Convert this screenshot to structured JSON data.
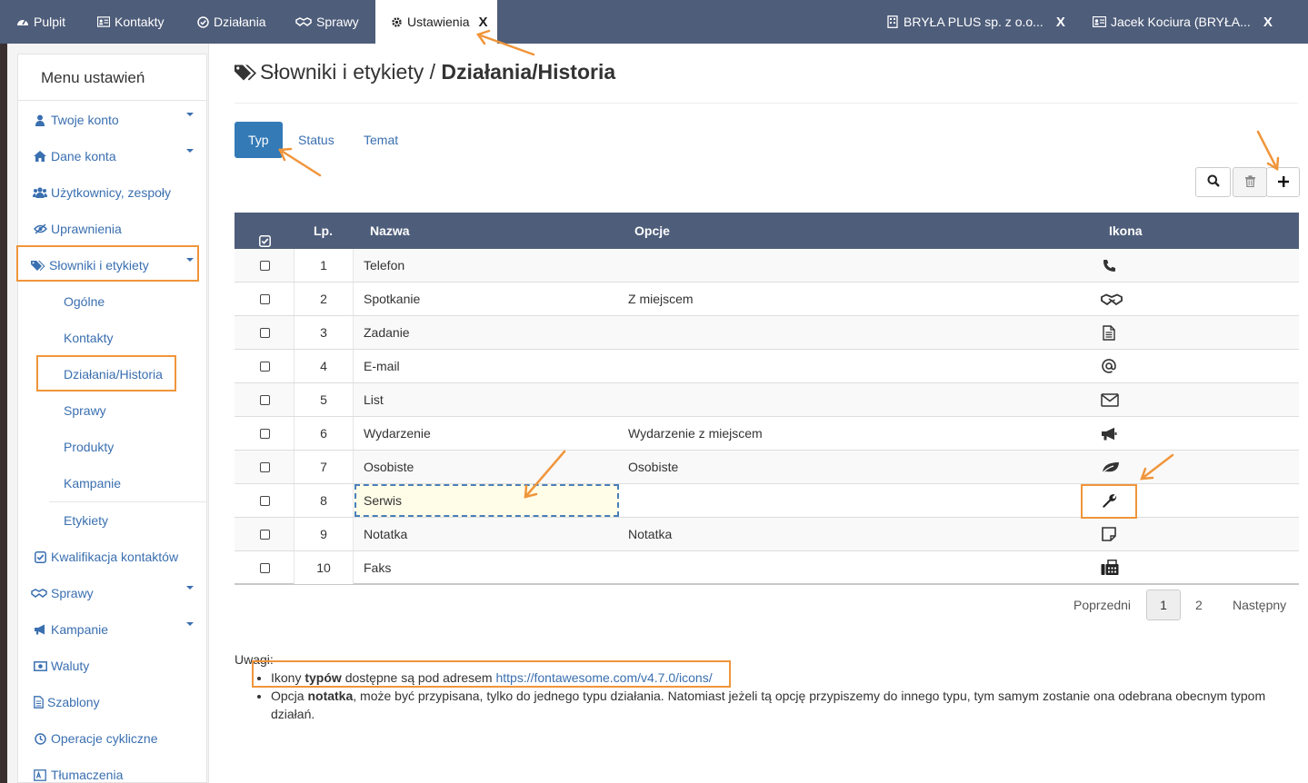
{
  "topbar": {
    "tabs": [
      {
        "label": "Pulpit",
        "icon": "dashboard-icon"
      },
      {
        "label": "Kontakty",
        "icon": "address-card-icon"
      },
      {
        "label": "Działania",
        "icon": "check-circle-icon"
      },
      {
        "label": "Sprawy",
        "icon": "handshake-icon"
      },
      {
        "label": "Ustawienia",
        "icon": "gear-icon",
        "active": true,
        "close": "X"
      },
      {
        "label": "BRYŁA PLUS sp. z o.o...",
        "icon": "building-icon",
        "close": "X"
      },
      {
        "label": "Jacek Kociura (BRYŁA...",
        "icon": "address-card-icon",
        "close": "X"
      }
    ]
  },
  "sidebar": {
    "title": "Menu ustawień",
    "items": [
      {
        "label": "Twoje konto",
        "icon": "user-icon",
        "caret": true
      },
      {
        "label": "Dane konta",
        "icon": "home-icon",
        "caret": true
      },
      {
        "label": "Użytkownicy, zespoły",
        "icon": "users-icon"
      },
      {
        "label": "Uprawnienia",
        "icon": "eye-slash-icon"
      },
      {
        "label": "Słowniki i etykiety",
        "icon": "tags-icon",
        "caret": true,
        "active": true
      },
      {
        "label": "Kwalifikacja kontaktów",
        "icon": "check-square-icon"
      },
      {
        "label": "Sprawy",
        "icon": "handshake-icon",
        "caret": true
      },
      {
        "label": "Kampanie",
        "icon": "bullhorn-icon",
        "caret": true
      },
      {
        "label": "Waluty",
        "icon": "money-icon"
      },
      {
        "label": "Szablony",
        "icon": "file-text-icon"
      },
      {
        "label": "Operacje cykliczne",
        "icon": "clock-icon"
      },
      {
        "label": "Tłumaczenia",
        "icon": "language-icon"
      }
    ],
    "subitems": [
      "Ogólne",
      "Kontakty",
      "Działania/Historia",
      "Sprawy",
      "Produkty",
      "Kampanie",
      "Etykiety"
    ]
  },
  "main": {
    "title_prefix": "Słowniki i etykiety / ",
    "title_bold": "Działania/Historia",
    "tabs": [
      "Typ",
      "Status",
      "Temat"
    ],
    "toolbar": {
      "search_icon": "search-icon",
      "delete_icon": "trash-icon",
      "add_icon": "plus-icon"
    },
    "table": {
      "headers": {
        "lp": "Lp.",
        "name": "Nazwa",
        "options": "Opcje",
        "icon": "Ikona"
      },
      "rows": [
        {
          "lp": "1",
          "name": "Telefon",
          "options": "",
          "icon": "phone-icon"
        },
        {
          "lp": "2",
          "name": "Spotkanie",
          "options": "Z miejscem",
          "icon": "handshake-icon"
        },
        {
          "lp": "3",
          "name": "Zadanie",
          "options": "",
          "icon": "file-text-icon"
        },
        {
          "lp": "4",
          "name": "E-mail",
          "options": "",
          "icon": "at-icon"
        },
        {
          "lp": "5",
          "name": "List",
          "options": "",
          "icon": "envelope-icon"
        },
        {
          "lp": "6",
          "name": "Wydarzenie",
          "options": "Wydarzenie z miejscem",
          "icon": "bullhorn-icon"
        },
        {
          "lp": "7",
          "name": "Osobiste",
          "options": "Osobiste",
          "icon": "leaf-icon"
        },
        {
          "lp": "8",
          "name": "Serwis",
          "options": "",
          "icon": "wrench-icon",
          "editing": true
        },
        {
          "lp": "9",
          "name": "Notatka",
          "options": "Notatka",
          "icon": "sticky-note-icon"
        },
        {
          "lp": "10",
          "name": "Faks",
          "options": "",
          "icon": "fax-icon"
        }
      ]
    },
    "pager": {
      "prev": "Poprzedni",
      "pages": [
        "1",
        "2"
      ],
      "current": "1",
      "next": "Następny"
    },
    "notes": {
      "heading": "Uwagi:",
      "note1_pre": "Ikony ",
      "note1_bold": "typów",
      "note1_mid": " dostępne są pod adresem ",
      "note1_link": "https://fontawesome.com/v4.7.0/icons/",
      "note2_pre": "Opcja ",
      "note2_bold": "notatka",
      "note2_rest": ", może być przypisana, tylko do jednego typu działania. Natomiast jeżeli tą opcję przypiszemy do innego typu, tym samym zostanie ona odebrana obecnym typom działań."
    }
  },
  "colors": {
    "topbar": "#4e5d7a",
    "accent": "#337ab7",
    "link": "#3a6fb0",
    "annotation": "#f0953a"
  }
}
